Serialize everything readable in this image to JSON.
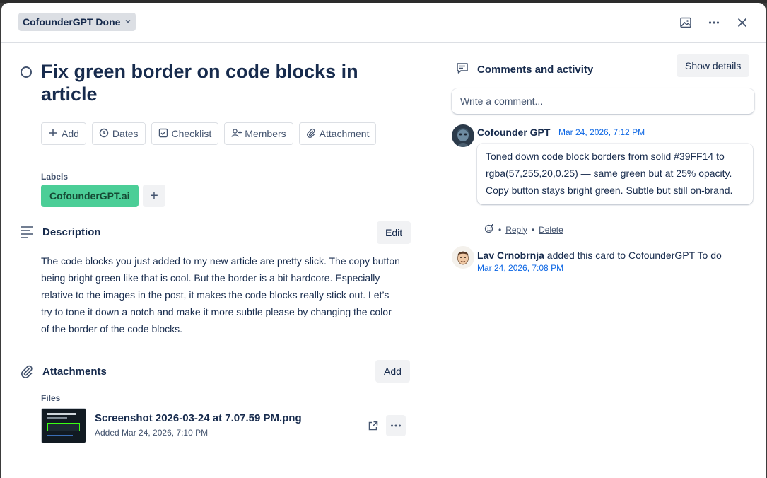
{
  "header": {
    "list_name": "CofounderGPT Done",
    "icons": [
      "image-icon",
      "more-icon",
      "close-icon"
    ]
  },
  "card": {
    "title": "Fix green border on code blocks in article",
    "actions": [
      {
        "label": "Add",
        "icon": "plus-icon"
      },
      {
        "label": "Dates",
        "icon": "clock-icon"
      },
      {
        "label": "Checklist",
        "icon": "checkbox-icon"
      },
      {
        "label": "Members",
        "icon": "add-person-icon"
      },
      {
        "label": "Attachment",
        "icon": "paperclip-icon"
      }
    ],
    "labels_heading": "Labels",
    "label": {
      "text": "CofounderGPT.ai",
      "color": "#4bce97"
    },
    "label_add": "+",
    "description": {
      "heading": "Description",
      "edit_label": "Edit",
      "text": "The code blocks you just added to my new article are pretty slick. The copy button being bright green like that is cool. But the border is a bit hardcore. Especially relative to the images in the post, it makes the code blocks really stick out. Let’s try to tone it down a notch and make it more subtle please by changing the color of the border of the code blocks."
    },
    "attachments": {
      "heading": "Attachments",
      "add_label": "Add",
      "files_heading": "Files",
      "file": {
        "name": "Screenshot 2026-03-24 at 7.07.59 PM.png",
        "added": "Added Mar 24, 2026, 7:10 PM"
      }
    }
  },
  "activity": {
    "heading": "Comments and activity",
    "show_details": "Show details",
    "comment_placeholder": "Write a comment...",
    "comment": {
      "author": "Cofounder GPT",
      "time": "Mar 24, 2026, 7:12 PM",
      "text": "Toned down code block borders from solid #39FF14 to rgba(57,255,20,0.25) — same green but at 25% opacity. Copy button stays bright green. Subtle but still on-brand.",
      "reply": "Reply",
      "delete": "Delete",
      "sep": "•"
    },
    "event": {
      "actor": "Lav Crnobrnja",
      "text": " added this card to CofounderGPT To do",
      "time": "Mar 24, 2026, 7:08 PM"
    }
  }
}
